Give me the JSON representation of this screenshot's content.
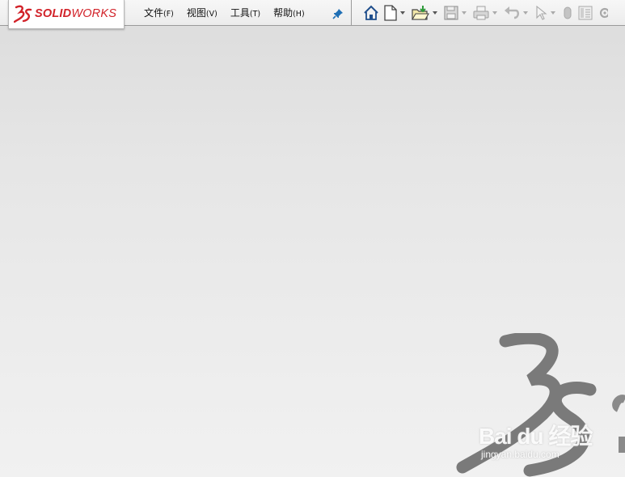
{
  "app": {
    "brand_prefix": "SOLID",
    "brand_suffix": "WORKS"
  },
  "menu": {
    "items": [
      {
        "label": "文件",
        "accel": "(F)"
      },
      {
        "label": "视图",
        "accel": "(V)"
      },
      {
        "label": "工具",
        "accel": "(T)"
      },
      {
        "label": "帮助",
        "accel": "(H)"
      }
    ]
  },
  "toolbar": {
    "icons": [
      "home-icon",
      "new-document-icon",
      "open-folder-icon",
      "save-icon",
      "print-icon",
      "undo-icon",
      "select-cursor-icon",
      "rebuild-icon",
      "options-icon"
    ]
  },
  "watermark": {
    "site": "Bai du 经验",
    "url": "jingyan.baidu.com"
  },
  "colors": {
    "brand_red": "#d2232a",
    "toolbar_icon_blue": "#1f4e8c",
    "pin_blue": "#1f6fb5",
    "watermark_gray": "#7a7a7a"
  }
}
